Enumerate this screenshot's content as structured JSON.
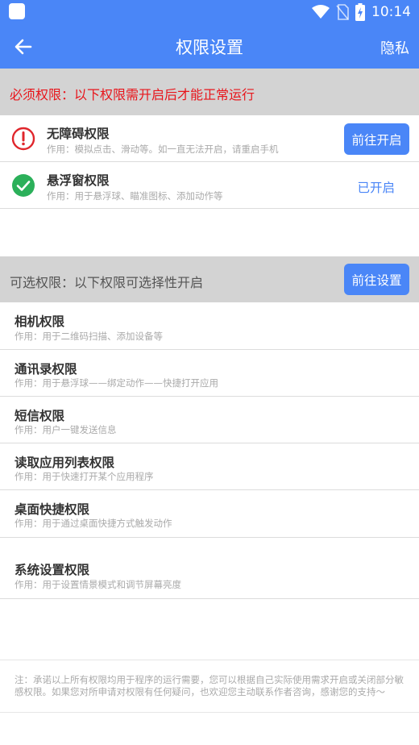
{
  "status_bar": {
    "time": "10:14",
    "wifi_icon": "wifi-icon",
    "signal_icon": "no-sim-icon",
    "battery_icon": "battery-charging-icon"
  },
  "app_bar": {
    "title": "权限设置",
    "right_action": "隐私",
    "back_icon": "arrow-left-icon"
  },
  "required": {
    "banner": "必须权限：以下权限需开启后才能正常运行",
    "items": [
      {
        "name": "无障碍权限",
        "desc": "作用：模拟点击、滑动等。如一直无法开启，请重启手机",
        "action": "前往开启",
        "icon": "alert-circle-icon",
        "status_color": "#e0262c"
      },
      {
        "name": "悬浮窗权限",
        "desc": "作用：用于悬浮球、瞄准图标、添加动作等",
        "action": "已开启",
        "icon": "check-circle-icon",
        "status_color": "#2bb05a"
      }
    ]
  },
  "optional": {
    "banner": "可选权限：以下权限可选择性开启",
    "action": "前往设置",
    "items": [
      {
        "name": "相机权限",
        "desc": "作用：用于二维码扫描、添加设备等"
      },
      {
        "name": "通讯录权限",
        "desc": "作用：用于悬浮球——绑定动作——快捷打开应用"
      },
      {
        "name": "短信权限",
        "desc": "作用：用户一键发送信息"
      },
      {
        "name": "读取应用列表权限",
        "desc": "作用：用于快速打开某个应用程序"
      },
      {
        "name": "桌面快捷权限",
        "desc": "作用：用于通过桌面快捷方式触发动作"
      },
      {
        "name": "系统设置权限",
        "desc": "作用：用于设置情景模式和调节屏幕亮度"
      }
    ]
  },
  "footer_note": "注：承诺以上所有权限均用于程序的运行需要，您可以根据自己实际使用需求开启或关闭部分敏感权限。如果您对所申请对权限有任何疑问，也欢迎您主动联系作者咨询，感谢您的支持～",
  "colors": {
    "accent": "#4a86f7",
    "warning": "#e8151b",
    "banner_bg": "#d3d3d3"
  }
}
